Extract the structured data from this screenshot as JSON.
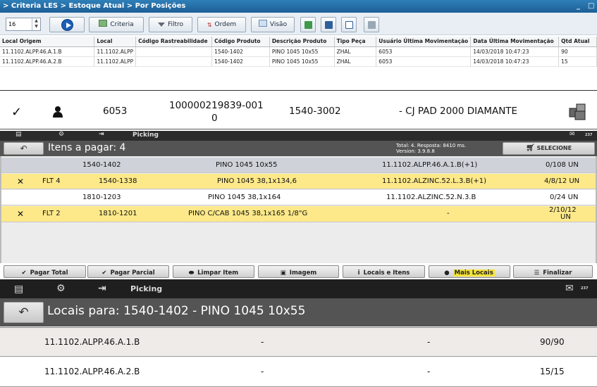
{
  "window": {
    "breadcrumb": "> Criteria LES > Estoque Atual > Por Posições",
    "minimize": "_",
    "maximize": "□"
  },
  "toolbar": {
    "spinner_value": "16",
    "buttons": {
      "criteria": "Criteria",
      "filtro": "Filtro",
      "ordem": "Ordem",
      "visao": "Visão"
    }
  },
  "grid": {
    "headers": [
      "Local Origem",
      "Local",
      "Código Rastreabilidade",
      "Código Produto",
      "Descrição Produto",
      "Tipo Peça",
      "Usuário Última Movimentação",
      "Data Última Movimentação",
      "Qtd Atual"
    ],
    "rows": [
      [
        "11.1102.ALPP.46.A.1.B",
        "11.1102.ALPP",
        "",
        "1540-1402",
        "PINO 1045 10x55",
        "ZHAL",
        "6053",
        "14/03/2018 10:47:23",
        "90"
      ],
      [
        "11.1102.ALPP.46.A.2.B",
        "11.1102.ALPP",
        "",
        "1540-1402",
        "PINO 1045 10x55",
        "ZHAL",
        "6053",
        "14/03/2018 10:47:23",
        "15"
      ]
    ]
  },
  "summary": {
    "user": "6053",
    "order_line1": "100000219839-001",
    "order_line2": "0",
    "product_code": "1540-3002",
    "description": "- CJ PAD 2000 DIAMANTE"
  },
  "picking1": {
    "app_title": "Picking",
    "badge": "237",
    "header_title": "Itens a pagar: 4",
    "stats_line1": "Total: 4. Resposta: 8410 ms.",
    "stats_line2": "Version: 3.9.8.8",
    "select_label": "SELECIONE",
    "rows": [
      {
        "mark": "",
        "flt": "",
        "code": "1540-1402",
        "desc": "PINO 1045 10x55",
        "local": "11.1102.ALPP.46.A.1.B(+1)",
        "qty": "0/108 UN"
      },
      {
        "mark": "✕",
        "flt": "FLT 4",
        "code": "1540-1338",
        "desc": "PINO 1045 38,1x134,6",
        "local": "11.1102.ALZINC.52.L.3.B(+1)",
        "qty": "4/8/12 UN"
      },
      {
        "mark": "",
        "flt": "",
        "code": "1810-1203",
        "desc": "PINO 1045 38,1x164",
        "local": "11.1102.ALZINC.52.N.3.B",
        "qty": "0/24 UN"
      },
      {
        "mark": "✕",
        "flt": "FLT 2",
        "code": "1810-1201",
        "desc": "PINO C/CAB 1045 38,1x165 1/8\"G",
        "local": "-",
        "qty": "2/10/12",
        "qty2": "UN"
      }
    ],
    "footer": [
      "Pagar Total",
      "Pagar Parcial",
      "Limpar Item",
      "Imagem",
      "Locais e Itens",
      "Mais Locais",
      "Finalizar"
    ]
  },
  "picking2": {
    "app_title": "Picking",
    "badge": "237",
    "header_title": "Locais para: 1540-1402 - PINO 1045 10x55",
    "rows": [
      {
        "local": "11.1102.ALPP.46.A.1.B",
        "a": "-",
        "b": "-",
        "qty": "90/90"
      },
      {
        "local": "11.1102.ALPP.46.A.2.B",
        "a": "-",
        "b": "-",
        "qty": "15/15"
      }
    ]
  },
  "colors": {
    "highlight_row": "#fde98a",
    "selected_row": "#cfd3d9",
    "header_bg": "#545454",
    "title_bar": "#2f7fb8"
  }
}
